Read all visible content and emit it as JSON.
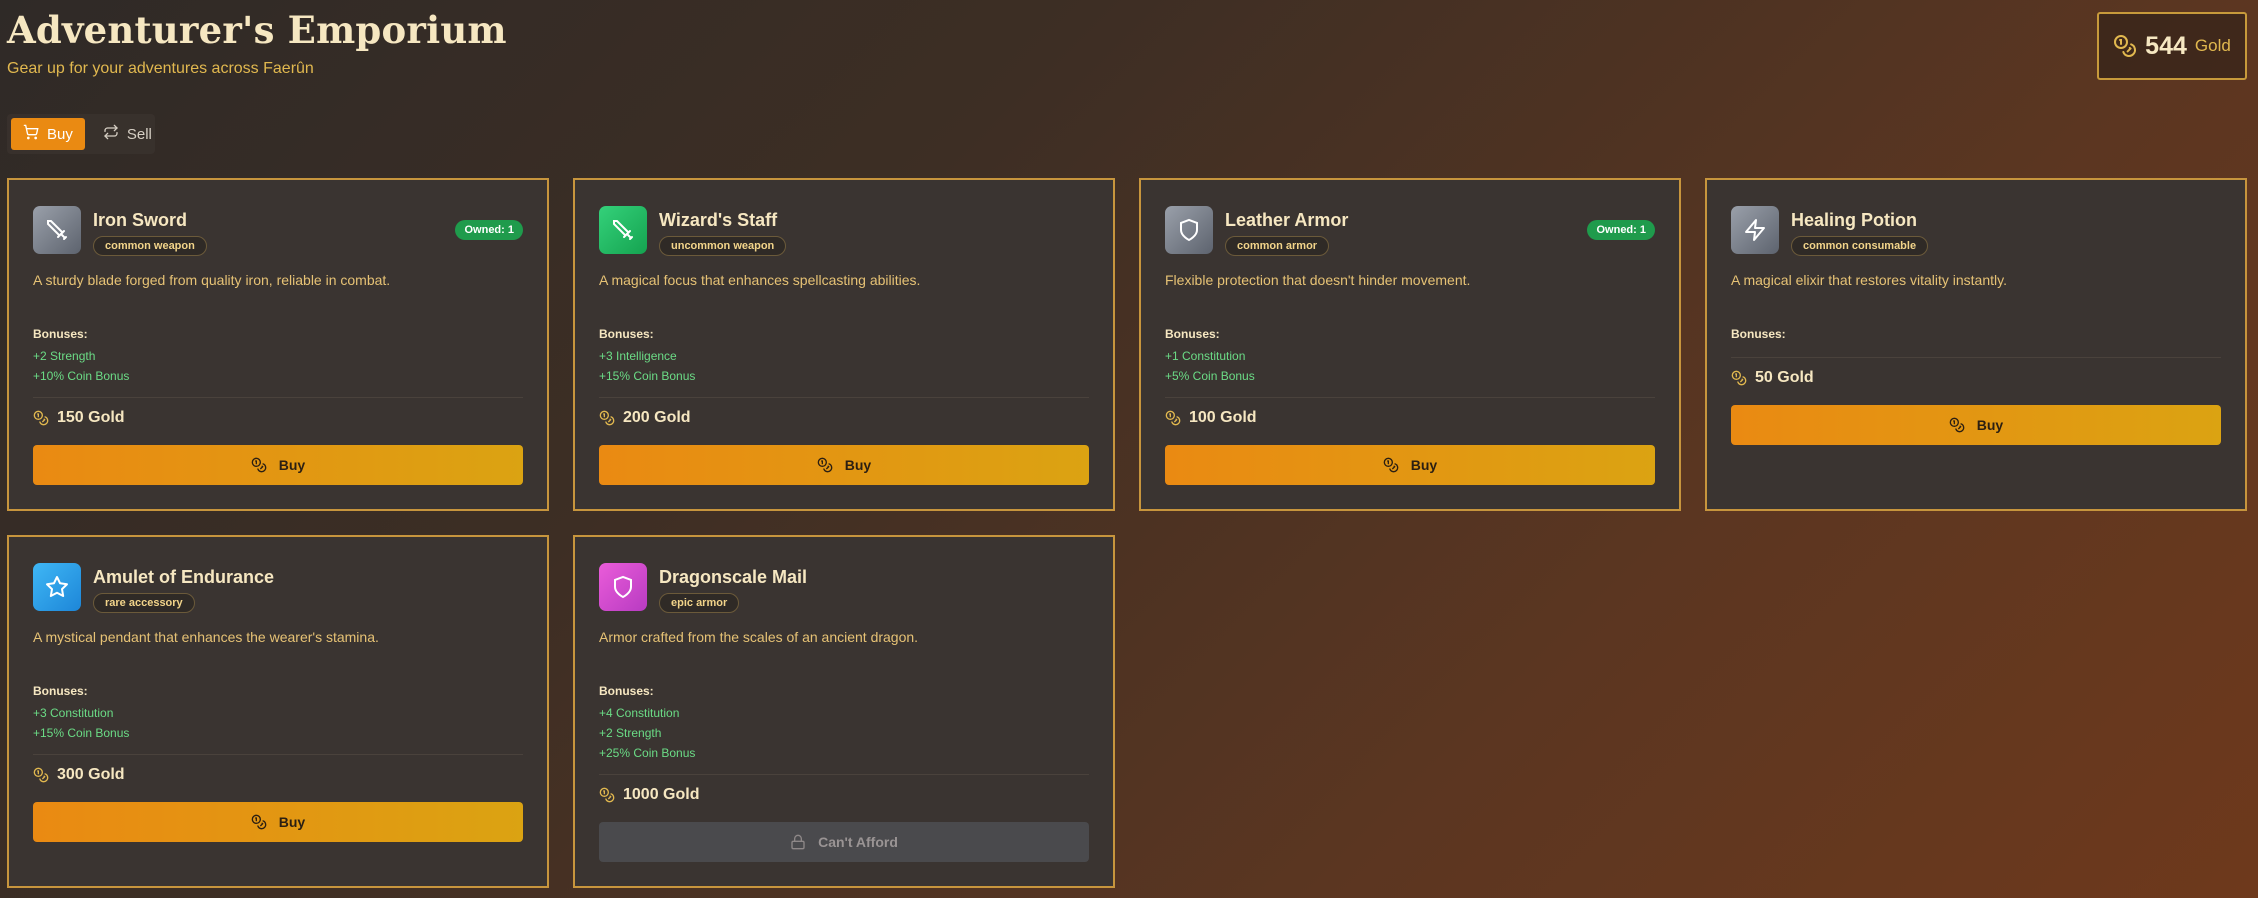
{
  "header": {
    "title": "Adventurer's Emporium",
    "subtitle": "Gear up for your adventures across Faerûn",
    "gold_amount": "544",
    "gold_unit": "Gold"
  },
  "tabs": [
    {
      "label": "Buy",
      "icon": "cart-icon",
      "active": true
    },
    {
      "label": "Sell",
      "icon": "swap-icon",
      "active": false
    }
  ],
  "colors": {
    "accent": "#ea8a12",
    "card_border": "#c7953d",
    "bonus_text": "#6bdc86",
    "owned_badge": "#1f9b4c"
  },
  "bonuses_label": "Bonuses:",
  "items": [
    {
      "name": "Iron Sword",
      "rarity": "common weapon",
      "icon": "sword-icon",
      "description": "A sturdy blade forged from quality iron, reliable in combat.",
      "bonuses": [
        "+2 Strength",
        "+10% Coin Bonus"
      ],
      "price": "150 Gold",
      "owned": "Owned: 1",
      "button": "Buy"
    },
    {
      "name": "Wizard's Staff",
      "rarity": "uncommon weapon",
      "icon": "staff-icon",
      "description": "A magical focus that enhances spellcasting abilities.",
      "bonuses": [
        "+3 Intelligence",
        "+15% Coin Bonus"
      ],
      "price": "200 Gold",
      "owned": "",
      "button": "Buy"
    },
    {
      "name": "Leather Armor",
      "rarity": "common armor",
      "icon": "shield-icon",
      "description": "Flexible protection that doesn't hinder movement.",
      "bonuses": [
        "+1 Constitution",
        "+5% Coin Bonus"
      ],
      "price": "100 Gold",
      "owned": "Owned: 1",
      "button": "Buy"
    },
    {
      "name": "Healing Potion",
      "rarity": "common consumable",
      "icon": "lightning-icon",
      "description": "A magical elixir that restores vitality instantly.",
      "bonuses": [],
      "price": "50 Gold",
      "owned": "",
      "button": "Buy"
    },
    {
      "name": "Amulet of Endurance",
      "rarity": "rare accessory",
      "icon": "star-icon",
      "description": "A mystical pendant that enhances the wearer's stamina.",
      "bonuses": [
        "+3 Constitution",
        "+15% Coin Bonus"
      ],
      "price": "300 Gold",
      "owned": "",
      "button": "Buy"
    },
    {
      "name": "Dragonscale Mail",
      "rarity": "epic armor",
      "icon": "shield-icon",
      "description": "Armor crafted from the scales of an ancient dragon.",
      "bonuses": [
        "+4 Constitution",
        "+2 Strength",
        "+25% Coin Bonus"
      ],
      "price": "1000 Gold",
      "owned": "",
      "button": "Can't Afford"
    }
  ]
}
